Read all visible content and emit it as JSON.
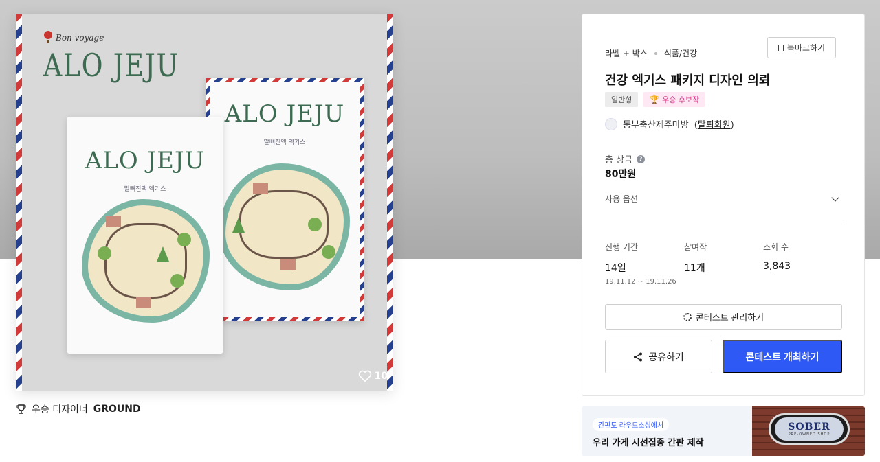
{
  "artwork": {
    "brand_small": "Bon voyage",
    "brand_title": "ALO JEJU",
    "package_title": "ALO JEJU",
    "package_subtitle": "말뼈진액 엑기스",
    "likes": "10",
    "colors": {
      "red_stripe": "#d23a3a",
      "blue_stripe": "#25408f",
      "green_text": "#3d6b52"
    }
  },
  "winner": {
    "label": "우승 디자이너",
    "name": "GROUND",
    "icon": "trophy-icon"
  },
  "contest": {
    "category_primary": "라벨 + 박스",
    "category_secondary": "식품/건강",
    "bookmark_label": "북마크하기",
    "title": "건강 엑기스 패키지 디자인 의뢰",
    "badges": [
      "일반형",
      "우승 후보작"
    ],
    "owner_name": "동부축산제주마방",
    "owner_status": "탈퇴회원",
    "prize_label": "총 상금",
    "prize_value": "80만원",
    "options_label": "사용 옵션",
    "stats": {
      "period_label": "진행 기간",
      "period_value": "14일",
      "period_range": "19.11.12 ~ 19.11.26",
      "participants_label": "참여작",
      "participants_value": "11개",
      "views_label": "조회 수",
      "views_value": "3,843"
    },
    "manage_label": "콘테스트 관리하기",
    "share_label": "공유하기",
    "open_label": "콘테스트 개최하기",
    "accent_color": "#2f59f5"
  },
  "ad": {
    "tag": "간판도 라우드소싱에서",
    "text": "우리 가게 시선집중 간판 제작",
    "sign_main": "SOBER",
    "sign_sub": "PRE-OWNED SHOP"
  }
}
